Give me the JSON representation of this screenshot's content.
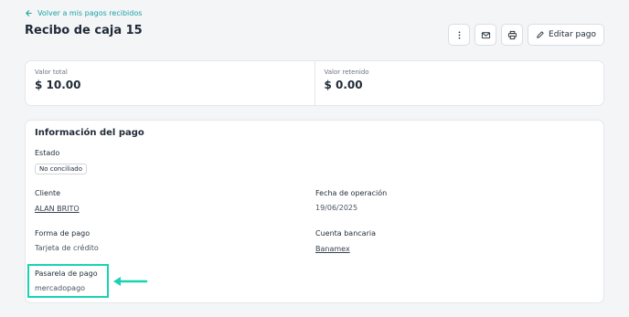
{
  "header": {
    "back_link": "Volver a mis pagos recibidos",
    "title": "Recibo de caja 15",
    "edit_label": "Editar pago"
  },
  "summary": {
    "total_label": "Valor total",
    "total_value": "$ 10.00",
    "retained_label": "Valor retenido",
    "retained_value": "$ 0.00"
  },
  "details": {
    "section_title": "Información del pago",
    "estado_label": "Estado",
    "estado_value": "No conciliado",
    "cliente_label": "Cliente",
    "cliente_value": "ALAN BRITO",
    "fecha_label": "Fecha de operación",
    "fecha_value": "19/06/2025",
    "forma_label": "Forma de pago",
    "forma_value": "Tarjeta de crédito",
    "cuenta_label": "Cuenta bancaria",
    "cuenta_value": "Banamex",
    "pasarela_label": "Pasarela de pago",
    "pasarela_value": "mercadopago"
  },
  "colors": {
    "accent": "#1aa3a3",
    "highlight": "#19d3b2"
  },
  "icons": [
    "arrow-left-icon",
    "more-vertical-icon",
    "mail-icon",
    "print-icon",
    "pencil-icon"
  ]
}
